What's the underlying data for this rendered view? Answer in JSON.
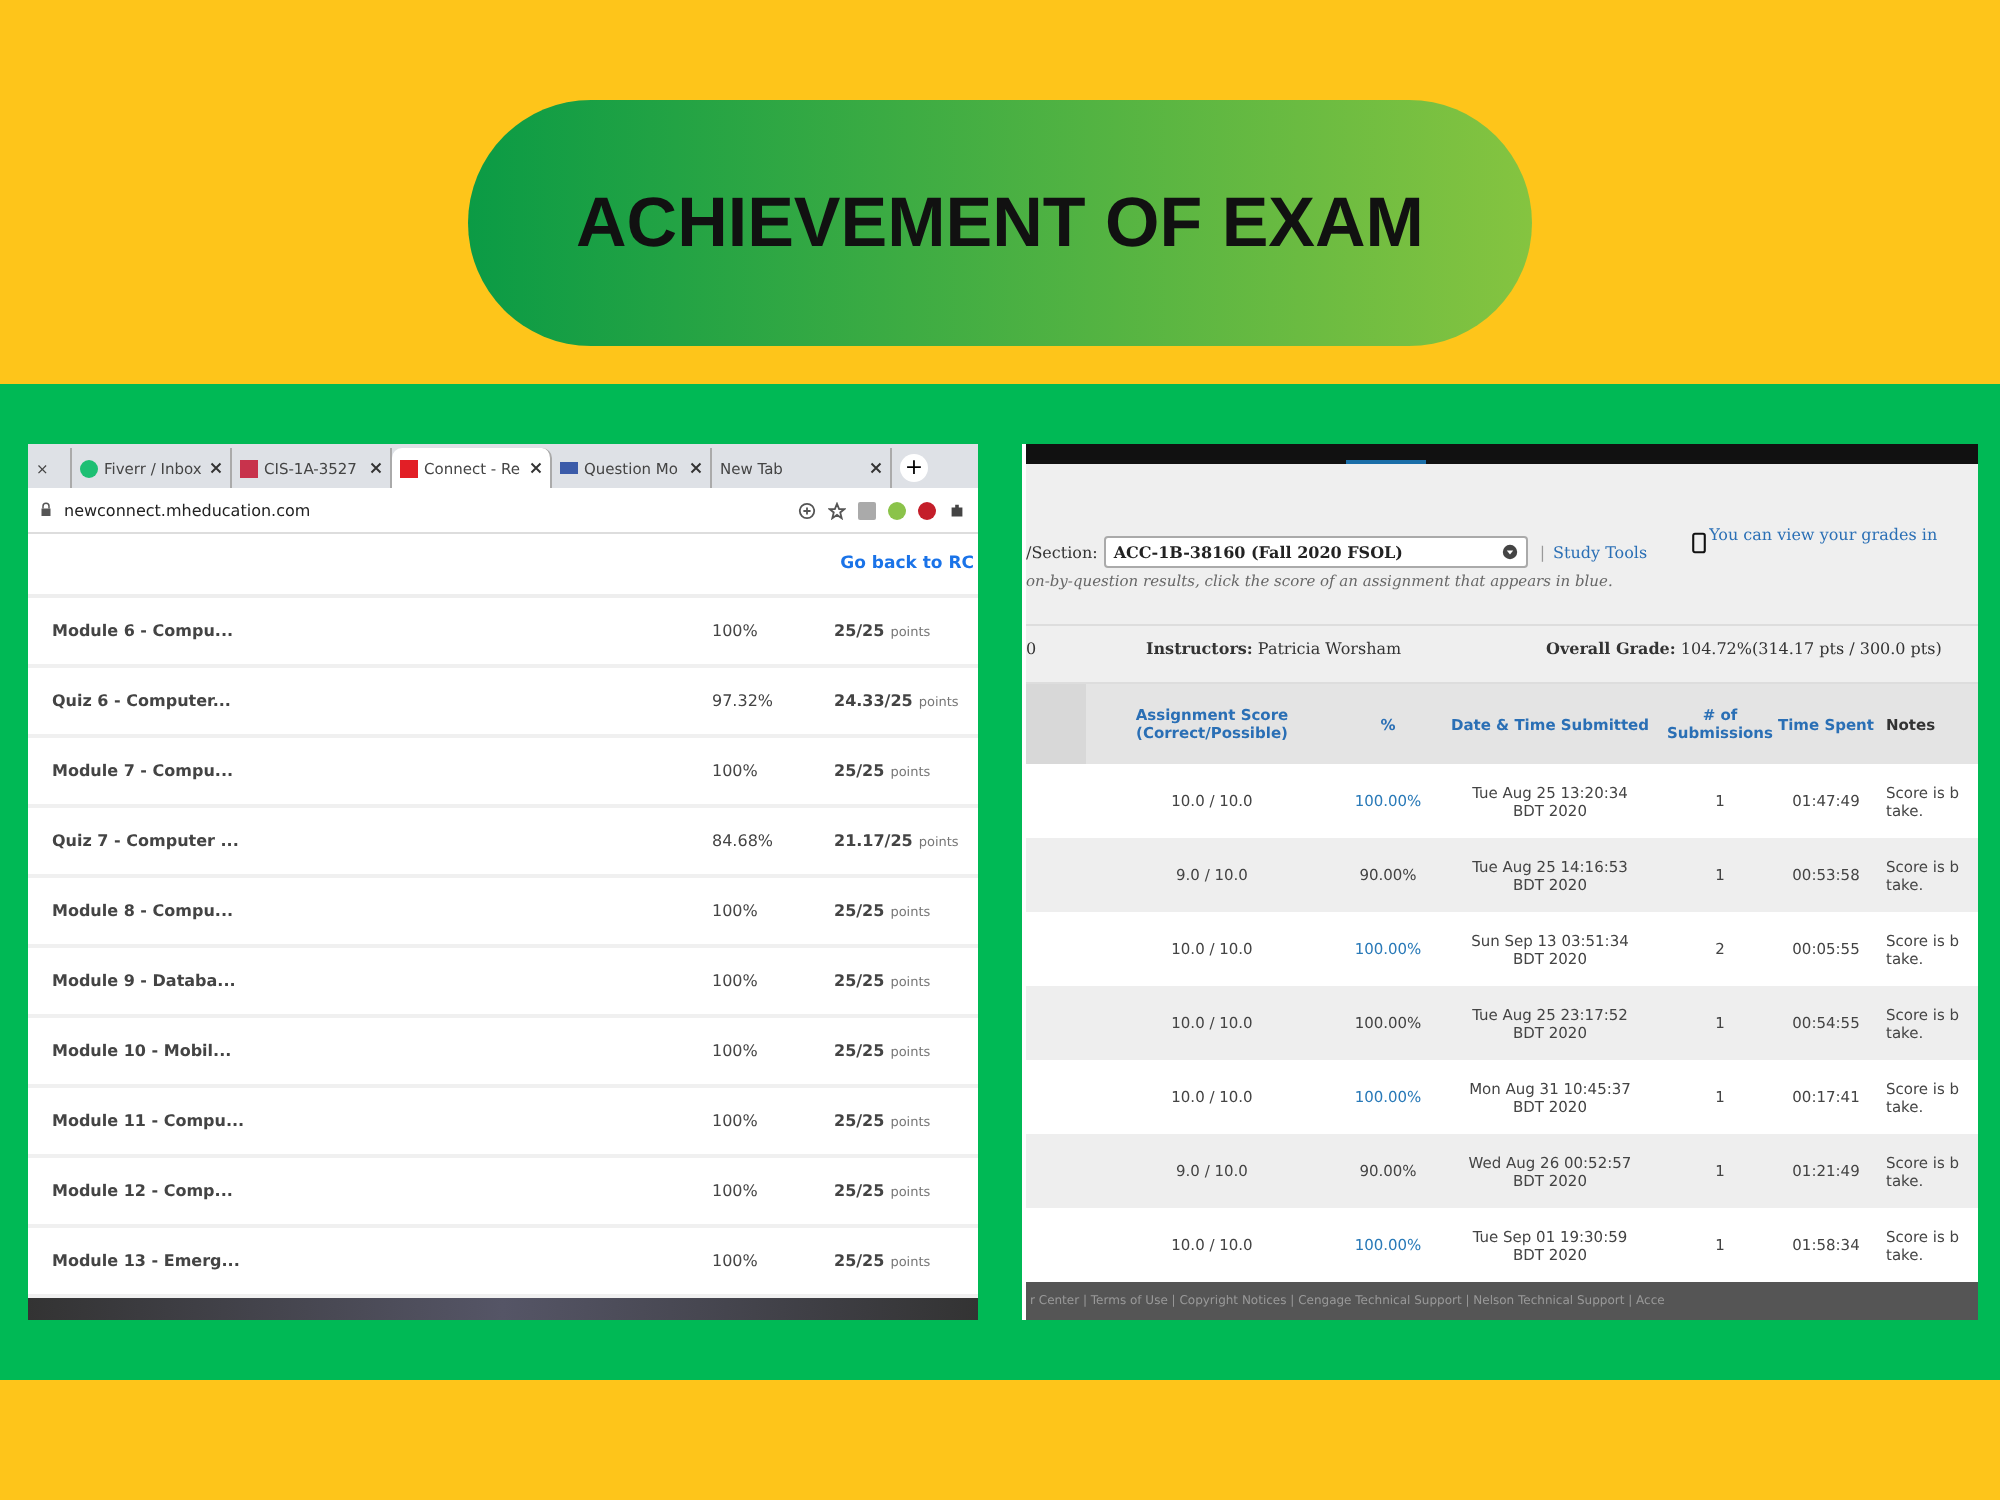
{
  "title": "ACHIEVEMENT OF EXAM",
  "left_browser": {
    "tabs": [
      {
        "label": "×",
        "selected": false,
        "kind": "stub"
      },
      {
        "label": "Fiverr / Inbox",
        "selected": false,
        "kind": "fiverr"
      },
      {
        "label": "CIS-1A-3527",
        "selected": false,
        "kind": "doc"
      },
      {
        "label": "Connect - Re",
        "selected": true,
        "kind": "connect"
      },
      {
        "label": "Question Mo",
        "selected": false,
        "kind": "grid"
      },
      {
        "label": "New Tab",
        "selected": false,
        "kind": "plain"
      }
    ],
    "new_tab": "+",
    "address": "newconnect.mheducation.com",
    "link": "Go back to RC",
    "rows": [
      {
        "name": "Module 6 - Compu...",
        "percent": "100%",
        "score": "25/25",
        "unit": "points"
      },
      {
        "name": "Quiz 6 - Computer...",
        "percent": "97.32%",
        "score": "24.33/25",
        "unit": "points"
      },
      {
        "name": "Module 7 - Compu...",
        "percent": "100%",
        "score": "25/25",
        "unit": "points"
      },
      {
        "name": "Quiz 7 - Computer ...",
        "percent": "84.68%",
        "score": "21.17/25",
        "unit": "points"
      },
      {
        "name": "Module 8 - Compu...",
        "percent": "100%",
        "score": "25/25",
        "unit": "points"
      },
      {
        "name": "Module 9 - Databa...",
        "percent": "100%",
        "score": "25/25",
        "unit": "points"
      },
      {
        "name": "Module 10 - Mobil...",
        "percent": "100%",
        "score": "25/25",
        "unit": "points"
      },
      {
        "name": "Module 11 - Compu...",
        "percent": "100%",
        "score": "25/25",
        "unit": "points"
      },
      {
        "name": "Module 12 - Comp...",
        "percent": "100%",
        "score": "25/25",
        "unit": "points"
      },
      {
        "name": "Module 13 - Emerg...",
        "percent": "100%",
        "score": "25/25",
        "unit": "points"
      }
    ]
  },
  "right_page": {
    "section_label": "/Section:",
    "section_value": "ACC-1B-38160 (Fall 2020 FSOL)",
    "separator": "|",
    "study_tools": "Study Tools",
    "mobile_note": "You can view your grades in",
    "hint": "on-by-question results, click the score of an assignment that appears in blue.",
    "cut_value": "0",
    "instructors_label": "Instructors:",
    "instructors": "Patricia Worsham",
    "grade_label": "Overall Grade:",
    "grade": "104.72%(314.17 pts / 300.0 pts)",
    "columns": [
      "Assignment Score (Correct/Possible)",
      "%",
      "Date & Time Submitted",
      "# of Submissions",
      "Time Spent",
      "Notes"
    ],
    "rows": [
      {
        "score": "10.0 / 10.0",
        "percent": "100.00%",
        "linked": true,
        "date": "Tue Aug 25 13:20:34 BDT 2020",
        "submissions": "1",
        "time": "01:47:49",
        "notes": "Score is b take."
      },
      {
        "score": "9.0 / 10.0",
        "percent": "90.00%",
        "linked": false,
        "date": "Tue Aug 25 14:16:53 BDT 2020",
        "submissions": "1",
        "time": "00:53:58",
        "notes": "Score is b take."
      },
      {
        "score": "10.0 / 10.0",
        "percent": "100.00%",
        "linked": true,
        "date": "Sun Sep 13 03:51:34 BDT 2020",
        "submissions": "2",
        "time": "00:05:55",
        "notes": "Score is b take."
      },
      {
        "score": "10.0 / 10.0",
        "percent": "100.00%",
        "linked": false,
        "date": "Tue Aug 25 23:17:52 BDT 2020",
        "submissions": "1",
        "time": "00:54:55",
        "notes": "Score is b take."
      },
      {
        "score": "10.0 / 10.0",
        "percent": "100.00%",
        "linked": true,
        "date": "Mon Aug 31 10:45:37 BDT 2020",
        "submissions": "1",
        "time": "00:17:41",
        "notes": "Score is b take."
      },
      {
        "score": "9.0 / 10.0",
        "percent": "90.00%",
        "linked": false,
        "date": "Wed Aug 26 00:52:57 BDT 2020",
        "submissions": "1",
        "time": "01:21:49",
        "notes": "Score is b take."
      },
      {
        "score": "10.0 / 10.0",
        "percent": "100.00%",
        "linked": true,
        "date": "Tue Sep 01 19:30:59 BDT 2020",
        "submissions": "1",
        "time": "01:58:34",
        "notes": "Score is b take."
      }
    ],
    "footer": "r Center | Terms of Use | Copyright Notices | Cengage Technical Support | Nelson Technical Support | Acce"
  }
}
